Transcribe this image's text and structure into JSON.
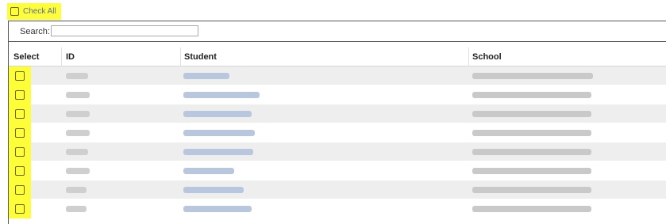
{
  "check_all": {
    "label": "Check All",
    "checked": false
  },
  "search": {
    "label": "Search:",
    "value": "",
    "placeholder": ""
  },
  "columns": [
    "Select",
    "ID",
    "Student",
    "School"
  ],
  "rows": [
    {
      "checked": false
    },
    {
      "checked": false
    },
    {
      "checked": false
    },
    {
      "checked": false
    },
    {
      "checked": false
    },
    {
      "checked": false
    },
    {
      "checked": false
    },
    {
      "checked": false
    }
  ],
  "colors": {
    "highlight": "#fdfd3a",
    "alt_row": "#eeeeee",
    "link_blur": "#b9c7de"
  }
}
